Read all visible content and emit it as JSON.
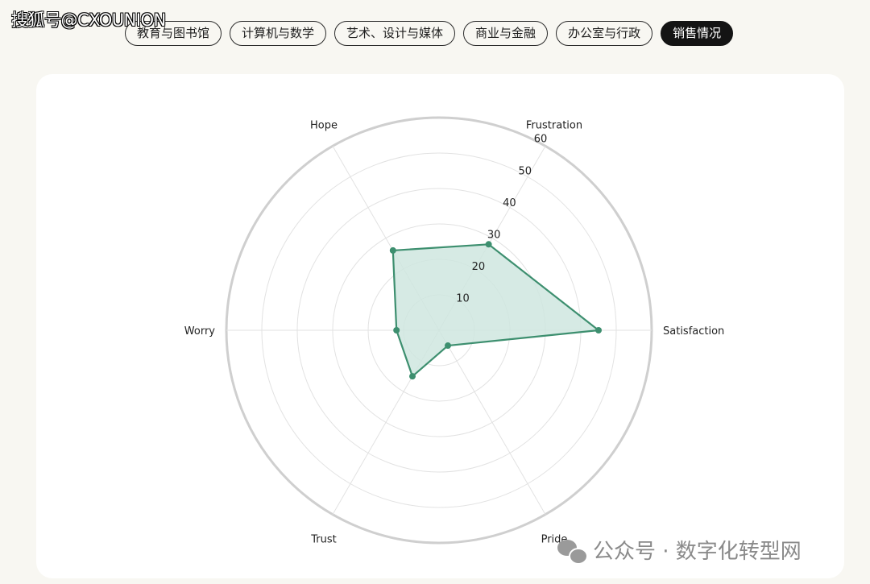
{
  "watermark_top": "搜狐号@CXOUNION",
  "tabs": [
    {
      "label": "教育与图书馆",
      "active": false
    },
    {
      "label": "计算机与数学",
      "active": false
    },
    {
      "label": "艺术、设计与媒体",
      "active": false
    },
    {
      "label": "商业与金融",
      "active": false
    },
    {
      "label": "办公室与行政",
      "active": false
    },
    {
      "label": "销售情况",
      "active": true
    }
  ],
  "watermark_bottom": "公众号 · 数字化转型网",
  "colors": {
    "series_stroke": "#3d8f6f",
    "series_fill": "#cfe6df",
    "grid": "#e2e2e2",
    "outer_ring": "#cfcfcf"
  },
  "chart_data": {
    "type": "radar",
    "axes": [
      "Satisfaction",
      "Frustration",
      "Hope",
      "Worry",
      "Trust",
      "Pride"
    ],
    "radial_ticks": [
      10,
      20,
      30,
      40,
      50,
      60
    ],
    "rlim": [
      0,
      60
    ],
    "series": [
      {
        "values": [
          45,
          28,
          26,
          12,
          15,
          5
        ]
      }
    ],
    "grid": true
  }
}
